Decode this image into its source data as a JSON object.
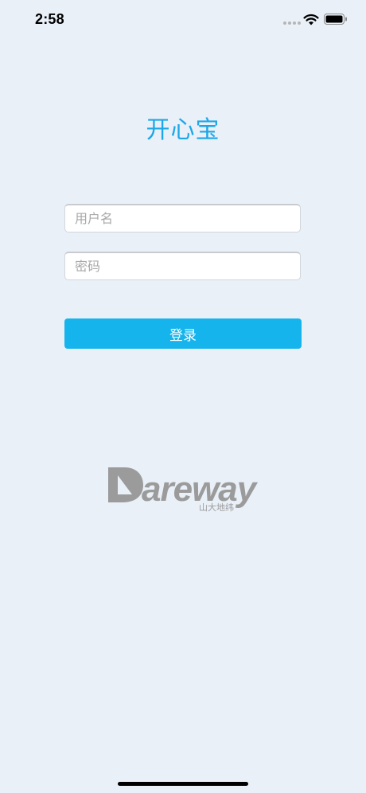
{
  "status_bar": {
    "time": "2:58",
    "signal_icon": "signal-dots-icon",
    "wifi_icon": "wifi-icon",
    "battery_icon": "battery-icon"
  },
  "app": {
    "title": "开心宝"
  },
  "login_form": {
    "username_placeholder": "用户名",
    "username_value": "",
    "password_placeholder": "密码",
    "password_value": "",
    "login_label": "登录"
  },
  "logo": {
    "wordmark": "Dareway",
    "subtitle": "山大地纬"
  },
  "colors": {
    "background": "#e9f0f8",
    "title": "#1ca7e8",
    "button": "#15b4ec",
    "logo_gray": "#9b9b9b"
  }
}
